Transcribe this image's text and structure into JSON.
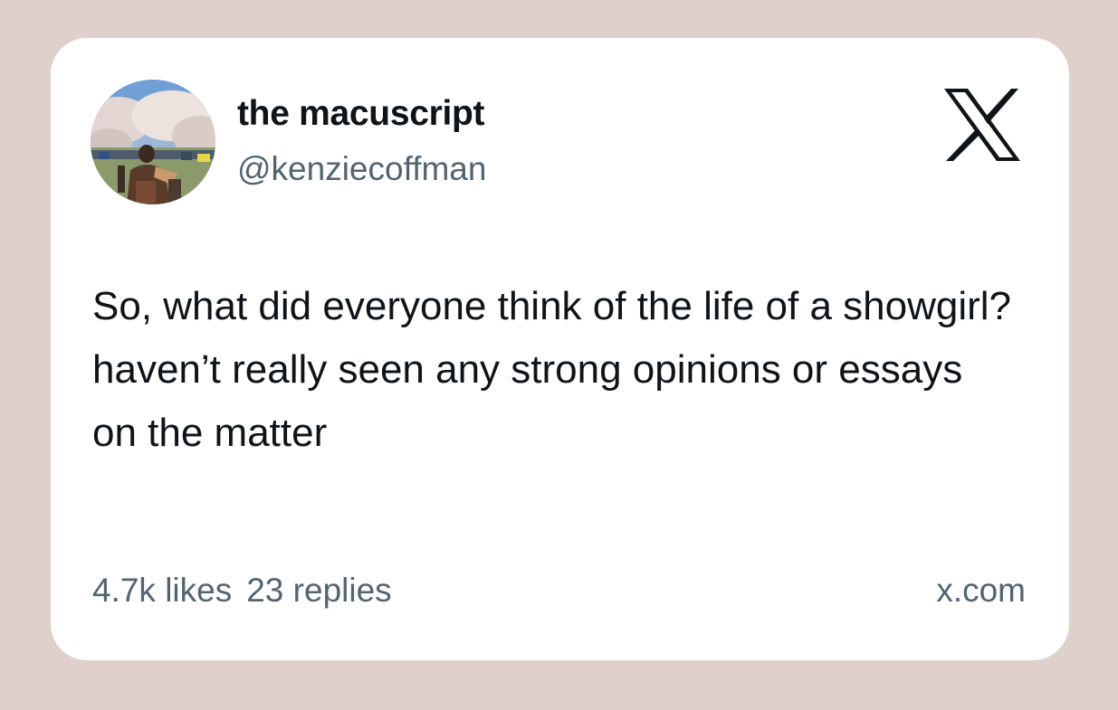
{
  "author": {
    "display_name": "the macuscript",
    "handle": "@kenziecoffman",
    "avatar": "profile-photo"
  },
  "brand": {
    "logo": "x-logo-icon"
  },
  "tweet": {
    "text": "So, what did everyone think of the life of a showgirl? haven’t really seen any strong opinions or essays on the matter"
  },
  "stats": {
    "likes": "4.7k likes",
    "replies": "23 replies"
  },
  "source": {
    "site": "x.com"
  },
  "colors": {
    "background": "#dfd0cb",
    "card": "#ffffff",
    "primary_text": "#0f1419",
    "secondary_text": "#536471"
  }
}
